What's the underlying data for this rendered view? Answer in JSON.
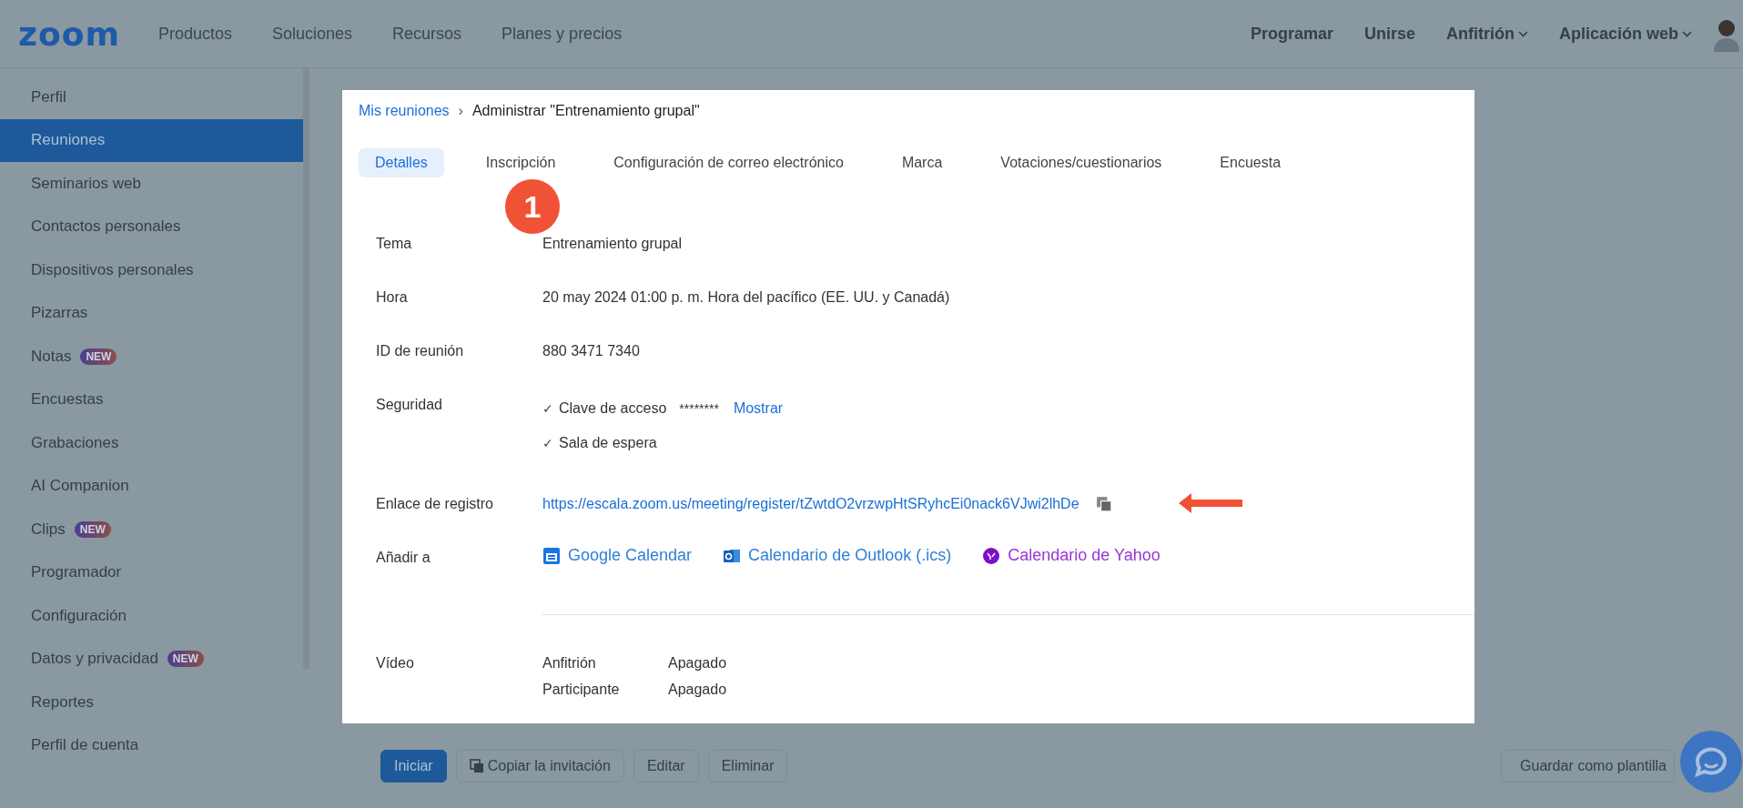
{
  "header": {
    "logo": "zoom",
    "nav": [
      "Productos",
      "Soluciones",
      "Recursos",
      "Planes y precios"
    ],
    "actions": [
      {
        "label": "Programar",
        "dropdown": false
      },
      {
        "label": "Unirse",
        "dropdown": false
      },
      {
        "label": "Anfitrión",
        "dropdown": true
      },
      {
        "label": "Aplicación web",
        "dropdown": true
      }
    ]
  },
  "sidebar": {
    "items": [
      {
        "label": "Perfil",
        "selected": false
      },
      {
        "label": "Reuniones",
        "selected": true
      },
      {
        "label": "Seminarios web",
        "selected": false
      },
      {
        "label": "Contactos personales",
        "selected": false
      },
      {
        "label": "Dispositivos personales",
        "selected": false
      },
      {
        "label": "Pizarras",
        "selected": false
      },
      {
        "label": "Notas",
        "selected": false,
        "badge": "NEW"
      },
      {
        "label": "Encuestas",
        "selected": false
      },
      {
        "label": "Grabaciones",
        "selected": false
      },
      {
        "label": "AI Companion",
        "selected": false
      },
      {
        "label": "Clips",
        "selected": false,
        "badge": "NEW"
      },
      {
        "label": "Programador",
        "selected": false
      },
      {
        "label": "Configuración",
        "selected": false
      },
      {
        "label": "Datos y privacidad",
        "selected": false,
        "badge": "NEW"
      },
      {
        "label": "Reportes",
        "selected": false
      },
      {
        "label": "Perfil de cuenta",
        "selected": false
      }
    ]
  },
  "breadcrumb": {
    "link": "Mis reuniones",
    "separator": "›",
    "current": "Administrar \"Entrenamiento grupal\""
  },
  "tabs": [
    {
      "label": "Detalles",
      "selected": true
    },
    {
      "label": "Inscripción",
      "selected": false
    },
    {
      "label": "Configuración de correo electrónico",
      "selected": false
    },
    {
      "label": "Marca",
      "selected": false
    },
    {
      "label": "Votaciones/cuestionarios",
      "selected": false
    },
    {
      "label": "Encuesta",
      "selected": false
    }
  ],
  "step_marker": "1",
  "fields": [
    {
      "kind": "text",
      "label": "Tema",
      "value": "Entrenamiento grupal"
    },
    {
      "kind": "text",
      "label": "Hora",
      "value": "20 may 2024 01:00 p. m. Hora del pacífico (EE. UU. y Canadá)"
    },
    {
      "kind": "text",
      "label": "ID de reunión",
      "value": "880 3471 7340"
    },
    {
      "kind": "security",
      "label": "Seguridad",
      "options": [
        {
          "mark": "✓",
          "label": "Clave de acceso",
          "secret": "********",
          "action": "Mostrar"
        },
        {
          "mark": "✓",
          "label": "Sala de espera"
        }
      ]
    },
    {
      "kind": "link",
      "label": "Enlace de registro",
      "value": "https://escala.zoom.us/meeting/register/tZwtdO2vrzwpHtSRyhcEi0nack6VJwi2lhDe"
    },
    {
      "kind": "calendars",
      "label": "Añadir a",
      "calendars": [
        {
          "label": "Google Calendar",
          "color": "#2f7fd8"
        },
        {
          "label": "Calendario de Outlook (.ics)",
          "color": "#2f7fd8"
        },
        {
          "label": "Calendario de Yahoo",
          "color": "#9b34d6"
        }
      ]
    },
    {
      "kind": "divider"
    },
    {
      "kind": "video",
      "label": "Vídeo",
      "rows": [
        {
          "role": "Anfitrión",
          "state": "Apagado"
        },
        {
          "role": "Participante",
          "state": "Apagado"
        }
      ]
    }
  ],
  "actions": [
    {
      "label": "Iniciar",
      "kind": "primary"
    },
    {
      "label": "Copiar la invitación",
      "kind": "copy"
    },
    {
      "label": "Editar",
      "kind": "default"
    },
    {
      "label": "Eliminar",
      "kind": "default"
    }
  ],
  "save_template": "Guardar como plantilla"
}
